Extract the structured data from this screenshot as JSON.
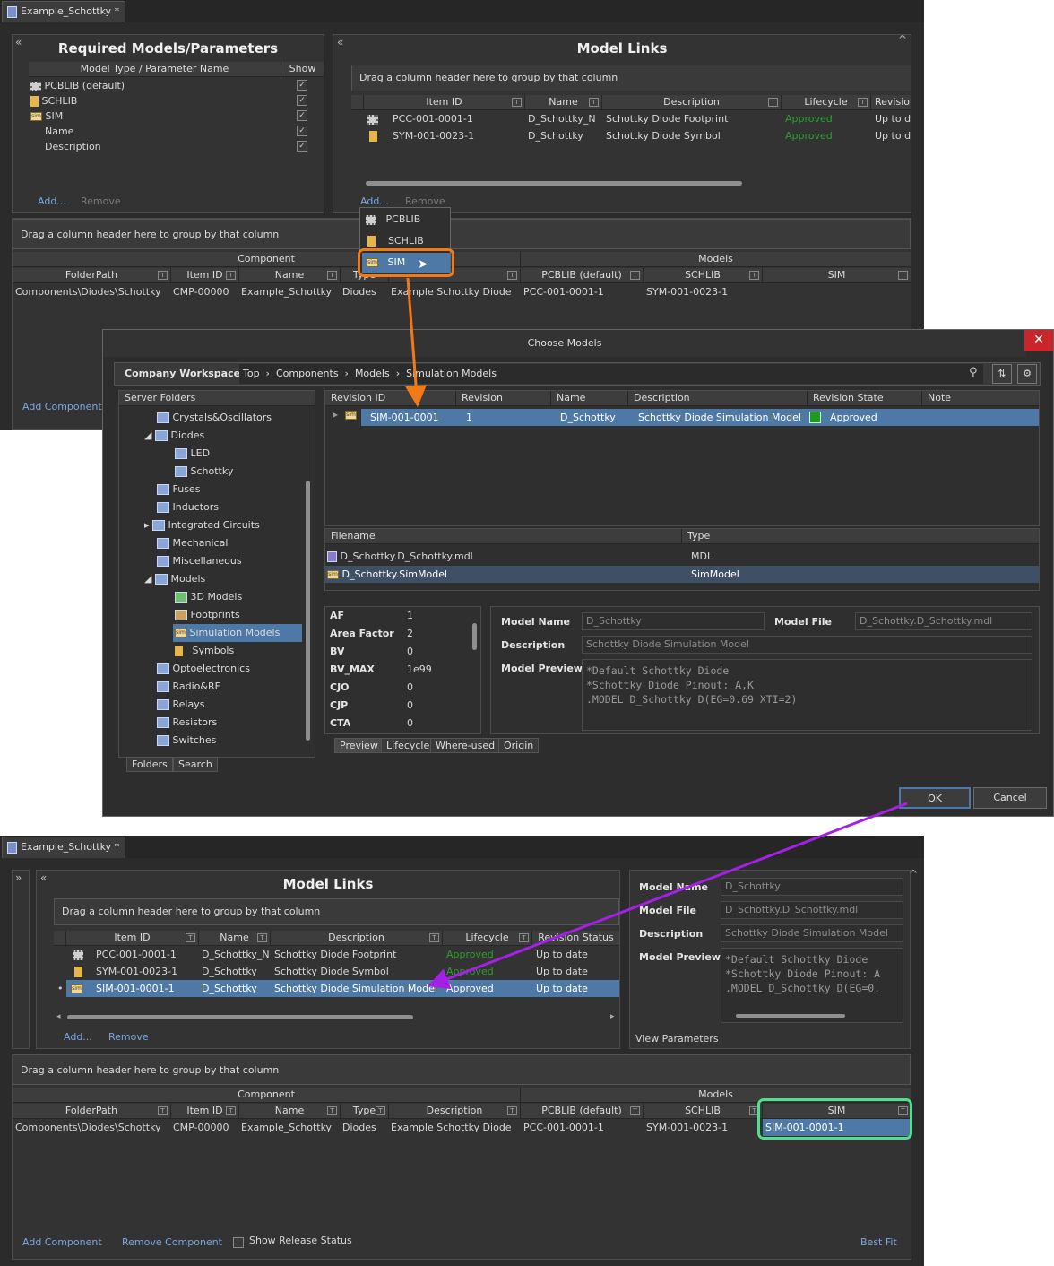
{
  "doc_tab": "Example_Schottky *",
  "required_panel": {
    "title": "Required Models/Parameters",
    "col_type": "Model Type / Parameter Name",
    "col_show": "Show",
    "rows": [
      "PCBLIB (default)",
      "SCHLIB",
      "SIM",
      "Name",
      "Description"
    ],
    "add": "Add...",
    "remove": "Remove"
  },
  "model_links": {
    "title": "Model Links",
    "drag_text": "Drag a column header here to group by that column",
    "headers": [
      "Item ID",
      "Name",
      "Description",
      "Lifecycle",
      "Revision",
      "Revision Status"
    ],
    "rows": [
      {
        "id": "PCC-001-0001-1",
        "name": "D_Schottky_N",
        "desc": "Schottky Diode Footprint",
        "life": "Approved",
        "rev": "Up to d",
        "rev_full": "Up to date"
      },
      {
        "id": "SYM-001-0023-1",
        "name": "D_Schottky",
        "desc": "Schottky Diode Symbol",
        "life": "Approved",
        "rev": "Up to d",
        "rev_full": "Up to date"
      },
      {
        "id": "SIM-001-0001-1",
        "name": "D_Schottky",
        "desc": "Schottky Diode Simulation Model",
        "life": "Approved",
        "rev": "Up to date"
      }
    ],
    "add": "Add...",
    "remove": "Remove"
  },
  "add_menu": [
    "PCBLIB",
    "SCHLIB",
    "SIM"
  ],
  "components": {
    "drag_text": "Drag a column header here to group by that column",
    "group_component": "Component",
    "group_models": "Models",
    "headers": [
      "FolderPath",
      "Item ID",
      "Name",
      "Type",
      "Description",
      "PCBLIB (default)",
      "SCHLIB",
      "SIM"
    ],
    "row": [
      "Components\\Diodes\\Schottky",
      "CMP-00000",
      "Example_Schottky",
      "Diodes",
      "Example Schottky Diode",
      "PCC-001-0001-1",
      "SYM-001-0023-1",
      "SIM-001-0001-1"
    ],
    "add_component": "Add Component",
    "remove_component": "Remove Component",
    "show_release": "Show Release Status",
    "best_fit": "Best Fit"
  },
  "dialog": {
    "title": "Choose Models",
    "workspace": "Company Workspace ▾",
    "breadcrumb": [
      "Top",
      "Components",
      "Models",
      "Simulation Models"
    ],
    "server_folders": "Server Folders",
    "tree": [
      "Crystals&Oscillators",
      "Diodes",
      "LED",
      "Schottky",
      "Fuses",
      "Inductors",
      "Integrated Circuits",
      "Mechanical",
      "Miscellaneous",
      "Models",
      "3D Models",
      "Footprints",
      "Simulation Models",
      "Symbols",
      "Optoelectronics",
      "Radio&RF",
      "Relays",
      "Resistors",
      "Switches"
    ],
    "rev_headers": [
      "Revision ID",
      "Revision",
      "Name",
      "Description",
      "Revision State",
      "Note"
    ],
    "rev_row": [
      "SIM-001-0001",
      "1",
      "D_Schottky",
      "Schottky Diode Simulation Model",
      "Approved"
    ],
    "file_headers": [
      "Filename",
      "Type"
    ],
    "files": [
      [
        "D_Schottky.D_Schottky.mdl",
        "MDL"
      ],
      [
        "D_Schottky.SimModel",
        "SimModel"
      ]
    ],
    "params": [
      [
        "AF",
        "1"
      ],
      [
        "Area Factor",
        "2"
      ],
      [
        "BV",
        "0"
      ],
      [
        "BV_MAX",
        "1e99"
      ],
      [
        "CJO",
        "0"
      ],
      [
        "CJP",
        "0"
      ],
      [
        "CTA",
        "0"
      ]
    ],
    "labels": {
      "model_name": "Model Name",
      "model_file": "Model File",
      "description": "Description",
      "model_preview": "Model Preview"
    },
    "values": {
      "model_name": "D_Schottky",
      "model_file": "D_Schottky.D_Schottky.mdl",
      "description": "Schottky Diode Simulation Model"
    },
    "preview": "*Default Schottky Diode\n*Schottky Diode Pinout: A,K\n.MODEL D_Schottky D(EG=0.69 XTI=2)",
    "bottom_tabs": [
      "Preview",
      "Lifecycle",
      "Where-used",
      "Origin"
    ],
    "left_tabs": [
      "Folders",
      "Search"
    ],
    "ok": "OK",
    "cancel": "Cancel"
  },
  "right_panel": {
    "preview_short": "*Default Schottky Diode\n*Schottky Diode Pinout: A\n.MODEL D_Schottky D(EG=0.",
    "view_params": "View Parameters"
  },
  "colors": {
    "accent_orange": "#f07a1a",
    "accent_green": "#4ee08a",
    "arrow_purple": "#a520e6",
    "selection": "#4e79a7"
  }
}
